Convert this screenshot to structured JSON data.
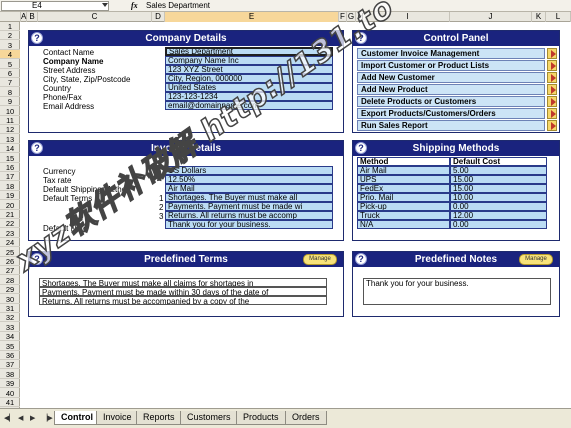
{
  "formula_bar": {
    "cell": "E4",
    "fx": "fx",
    "value": "Sales Department"
  },
  "columns": [
    "A",
    "B",
    "C",
    "D",
    "E",
    "F",
    "G",
    "H",
    "I",
    "J",
    "K",
    "L"
  ],
  "rows": [
    "1",
    "2",
    "3",
    "4",
    "5",
    "6",
    "7",
    "8",
    "9",
    "10",
    "11",
    "12",
    "13",
    "14",
    "15",
    "16",
    "17",
    "18",
    "19",
    "20",
    "21",
    "22",
    "23",
    "24",
    "25",
    "26",
    "27",
    "28",
    "29",
    "30",
    "31",
    "32",
    "33",
    "34",
    "35",
    "36",
    "37",
    "38",
    "39",
    "40",
    "41"
  ],
  "company": {
    "title": "Company Details",
    "fields": [
      {
        "label": "Contact Name",
        "value": "Sales Department"
      },
      {
        "label": "Company Name",
        "value": "Company Name Inc"
      },
      {
        "label": "Street Address",
        "value": "123 XYZ Street"
      },
      {
        "label": "City, State, Zip/Postcode",
        "value": "City, Region, 000000"
      },
      {
        "label": "Country",
        "value": "United States"
      },
      {
        "label": "Phone/Fax",
        "value": "123-123-1234"
      },
      {
        "label": "Email Address",
        "value": "email@domainname.com"
      }
    ]
  },
  "control": {
    "title": "Control Panel",
    "items": [
      "Customer Invoice Management",
      "Import Customer or Product Lists",
      "Add New Customer",
      "Add New Product",
      "Delete Products or Customers",
      "Export Products/Customers/Orders",
      "Run Sales Report"
    ]
  },
  "invoice": {
    "title": "Invoice Details",
    "fields": [
      {
        "label": "Currency",
        "value": "US Dollars"
      },
      {
        "label": "Tax rate",
        "value": "12.50%"
      },
      {
        "label": "Default Shipping Method",
        "value": "Air Mail"
      }
    ],
    "terms_label": "Default Terms",
    "terms": [
      {
        "num": "1",
        "value": "Shortages. The Buyer must make all"
      },
      {
        "num": "2",
        "value": "Payments. Payment must be made wi"
      },
      {
        "num": "3",
        "value": "Returns. All returns must be accomp"
      }
    ],
    "note_label": "Default Note",
    "note_value": "Thank you for your business."
  },
  "shipping": {
    "title": "Shipping Methods",
    "headers": [
      "Method",
      "Default Cost"
    ],
    "rows": [
      [
        "Air Mail",
        "5.00"
      ],
      [
        "UPS",
        "15.00"
      ],
      [
        "FedEx",
        "15.00"
      ],
      [
        "Prio. Mail",
        "10.00"
      ],
      [
        "Pick-up",
        "0.00"
      ],
      [
        "Truck",
        "12.00"
      ],
      [
        "N/A",
        "0.00"
      ]
    ]
  },
  "terms_panel": {
    "title": "Predefined Terms",
    "button": "Manage",
    "lines": [
      "Shortages. The Buyer must make all claims for shortages in",
      "Payments. Payment must be made within 30 days of the date of",
      "Returns. All returns must be accompanied by a copy of the"
    ]
  },
  "notes_panel": {
    "title": "Predefined Notes",
    "button": "Manage",
    "lines": [
      "Thank you for your business."
    ]
  },
  "tabs": [
    "Control",
    "Invoice",
    "Reports",
    "Customers",
    "Products",
    "Orders"
  ],
  "watermark": "xyz软件补破解 http://131.to",
  "colors": {
    "panel_title_bg": "#1a237e",
    "field_bg": "#bbdcf4",
    "header_sel": "#f7d79a"
  }
}
